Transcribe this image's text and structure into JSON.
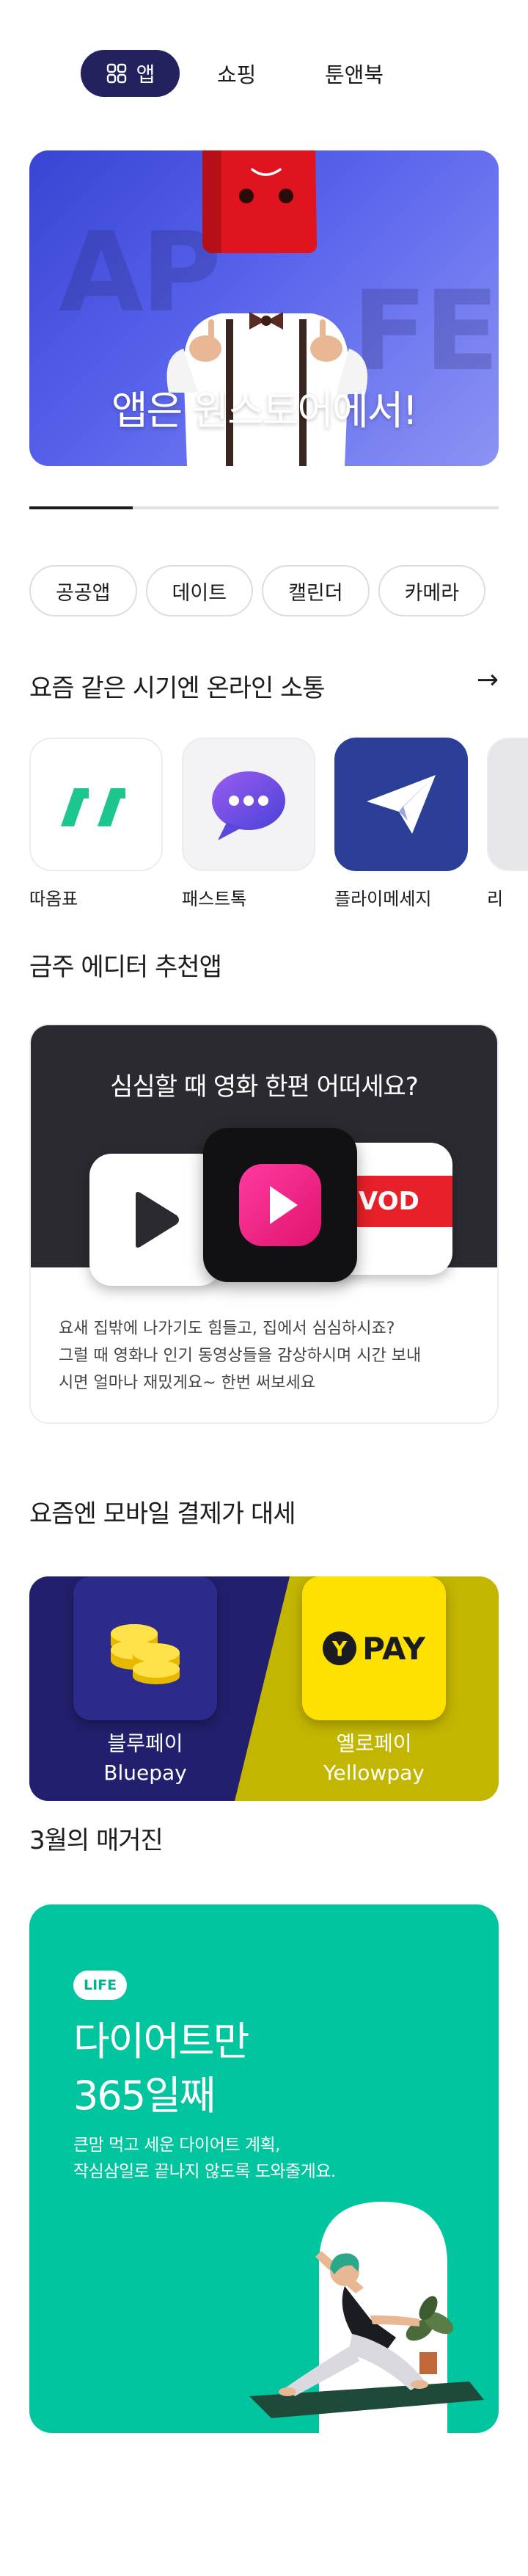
{
  "nav": {
    "tabs": [
      {
        "label": "앱",
        "active": true,
        "icon": "grid-icon"
      },
      {
        "label": "쇼핑",
        "active": false
      },
      {
        "label": "툰앤북",
        "active": false
      }
    ]
  },
  "hero": {
    "bg_text_1": "AP",
    "bg_text_2": "FE",
    "title": "앱은 원스토어에서!",
    "progress": 0.22
  },
  "chips": [
    "공공앱",
    "데이트",
    "캘린더",
    "카메라"
  ],
  "online": {
    "title": "요즘 같은 시기엔 온라인 소통",
    "apps": [
      {
        "label": "따옴표",
        "icon": "quote-icon"
      },
      {
        "label": "패스트톡",
        "icon": "chat-bubble-icon"
      },
      {
        "label": "플라이메세지",
        "icon": "paper-plane-icon"
      },
      {
        "label": "리",
        "icon": "app-icon"
      }
    ]
  },
  "editor": {
    "title": "금주 에디터 추천앱",
    "headline": "심심할 때 영화 한편 어떠세요?",
    "vod_label": "VOD",
    "desc_line1": "요새 집밖에 나가기도 힘들고, 집에서 심심하시죠?",
    "desc_line2": "그럴 때 영화나 인기 동영상들을 감상하시며 시간 보내",
    "desc_line3": "시면 얼마나 재밌게요~ 한번 써보세요"
  },
  "payment": {
    "title": "요즘엔 모바일 결제가 대세",
    "left": {
      "name_ko": "블루페이",
      "name_en": "Bluepay"
    },
    "right": {
      "name_ko": "옐로페이",
      "name_en": "Yellowpay",
      "logo_y": "Y",
      "logo_text": "PAY"
    },
    "colors": {
      "blue": "#22206e",
      "yellow_bg": "#c3b600",
      "yellow_icon": "#ffe100"
    }
  },
  "magazine": {
    "title": "3월의 매거진",
    "badge": "LIFE",
    "headline_1": "다이어트만",
    "headline_2": "365일째",
    "desc_1": "큰맘 먹고 세운 다이어트 계획,",
    "desc_2": "작심삼일로 끝나지 않도록 도와줄게요.",
    "color": "#00c59e"
  }
}
